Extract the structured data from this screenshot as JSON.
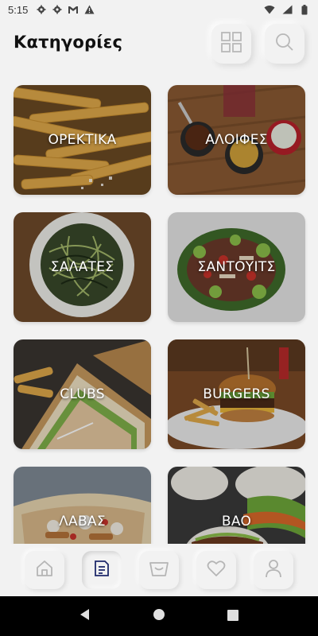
{
  "status_bar": {
    "time": "5:15",
    "left_icons": [
      "gear-icon",
      "gear-icon",
      "gmail-icon",
      "warning-icon"
    ],
    "right_icons": [
      "wifi-icon",
      "signal-icon",
      "battery-icon"
    ]
  },
  "header": {
    "title": "Κατηγορίες",
    "grid_button_icon": "grid-icon",
    "search_button_icon": "search-icon"
  },
  "categories": [
    {
      "label": "ΟΡΕΚΤΙΚΑ",
      "image": "fries"
    },
    {
      "label": "ΑΛΟΙΦΕΣ",
      "image": "dips"
    },
    {
      "label": "ΣΑΛΑΤΕΣ",
      "image": "salad"
    },
    {
      "label": "ΣΑΝΤΟΥΙΤΣ",
      "image": "sandwich"
    },
    {
      "label": "CLUBS",
      "image": "club"
    },
    {
      "label": "BURGERS",
      "image": "burger"
    },
    {
      "label": "ΛΑΒΑΣ",
      "image": "pita"
    },
    {
      "label": "BAO",
      "image": "bao"
    }
  ],
  "bottom_nav": {
    "items": [
      {
        "icon": "home-icon",
        "active": false
      },
      {
        "icon": "menu-icon",
        "active": true
      },
      {
        "icon": "basket-icon",
        "active": false
      },
      {
        "icon": "heart-icon",
        "active": false
      },
      {
        "icon": "user-icon",
        "active": false
      }
    ]
  },
  "colors": {
    "background": "#f2f2f2",
    "accent": "#1f2a6b",
    "icon_inactive": "#b5b5b5"
  }
}
